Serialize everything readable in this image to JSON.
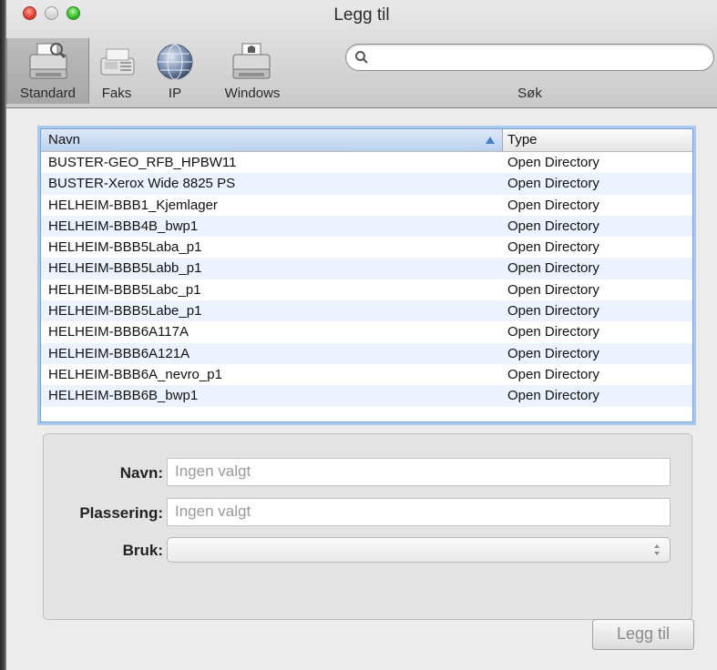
{
  "window": {
    "title": "Legg til"
  },
  "toolbar": {
    "items": [
      {
        "label": "Standard",
        "icon": "printer-icon",
        "selected": true
      },
      {
        "label": "Faks",
        "icon": "fax-icon",
        "selected": false
      },
      {
        "label": "IP",
        "icon": "globe-icon",
        "selected": false
      },
      {
        "label": "Windows",
        "icon": "windows-printer-icon",
        "selected": false
      }
    ],
    "search": {
      "label": "Søk",
      "value": "",
      "placeholder": ""
    }
  },
  "printer_list": {
    "columns": [
      "Navn",
      "Type"
    ],
    "sort": {
      "column": "Navn",
      "direction": "ascending"
    },
    "rows": [
      {
        "name": "BUSTER-GEO_RFB_HPBW11",
        "type": "Open Directory"
      },
      {
        "name": "BUSTER-Xerox Wide 8825 PS",
        "type": "Open Directory"
      },
      {
        "name": "HELHEIM-BBB1_Kjemlager",
        "type": "Open Directory"
      },
      {
        "name": "HELHEIM-BBB4B_bwp1",
        "type": "Open Directory"
      },
      {
        "name": "HELHEIM-BBB5Laba_p1",
        "type": "Open Directory"
      },
      {
        "name": "HELHEIM-BBB5Labb_p1",
        "type": "Open Directory"
      },
      {
        "name": "HELHEIM-BBB5Labc_p1",
        "type": "Open Directory"
      },
      {
        "name": "HELHEIM-BBB5Labe_p1",
        "type": "Open Directory"
      },
      {
        "name": "HELHEIM-BBB6A117A",
        "type": "Open Directory"
      },
      {
        "name": "HELHEIM-BBB6A121A",
        "type": "Open Directory"
      },
      {
        "name": "HELHEIM-BBB6A_nevro_p1",
        "type": "Open Directory"
      },
      {
        "name": "HELHEIM-BBB6B_bwp1",
        "type": "Open Directory"
      }
    ]
  },
  "details": {
    "name_label": "Navn:",
    "name_value": "Ingen valgt",
    "location_label": "Plassering:",
    "location_value": "Ingen valgt",
    "use_label": "Bruk:",
    "use_value": ""
  },
  "actions": {
    "add_label": "Legg til"
  },
  "colors": {
    "selection_highlight": "#a8c8ee",
    "alt_row": "#edf3fe",
    "sort_arrow": "#4a7ec9"
  }
}
